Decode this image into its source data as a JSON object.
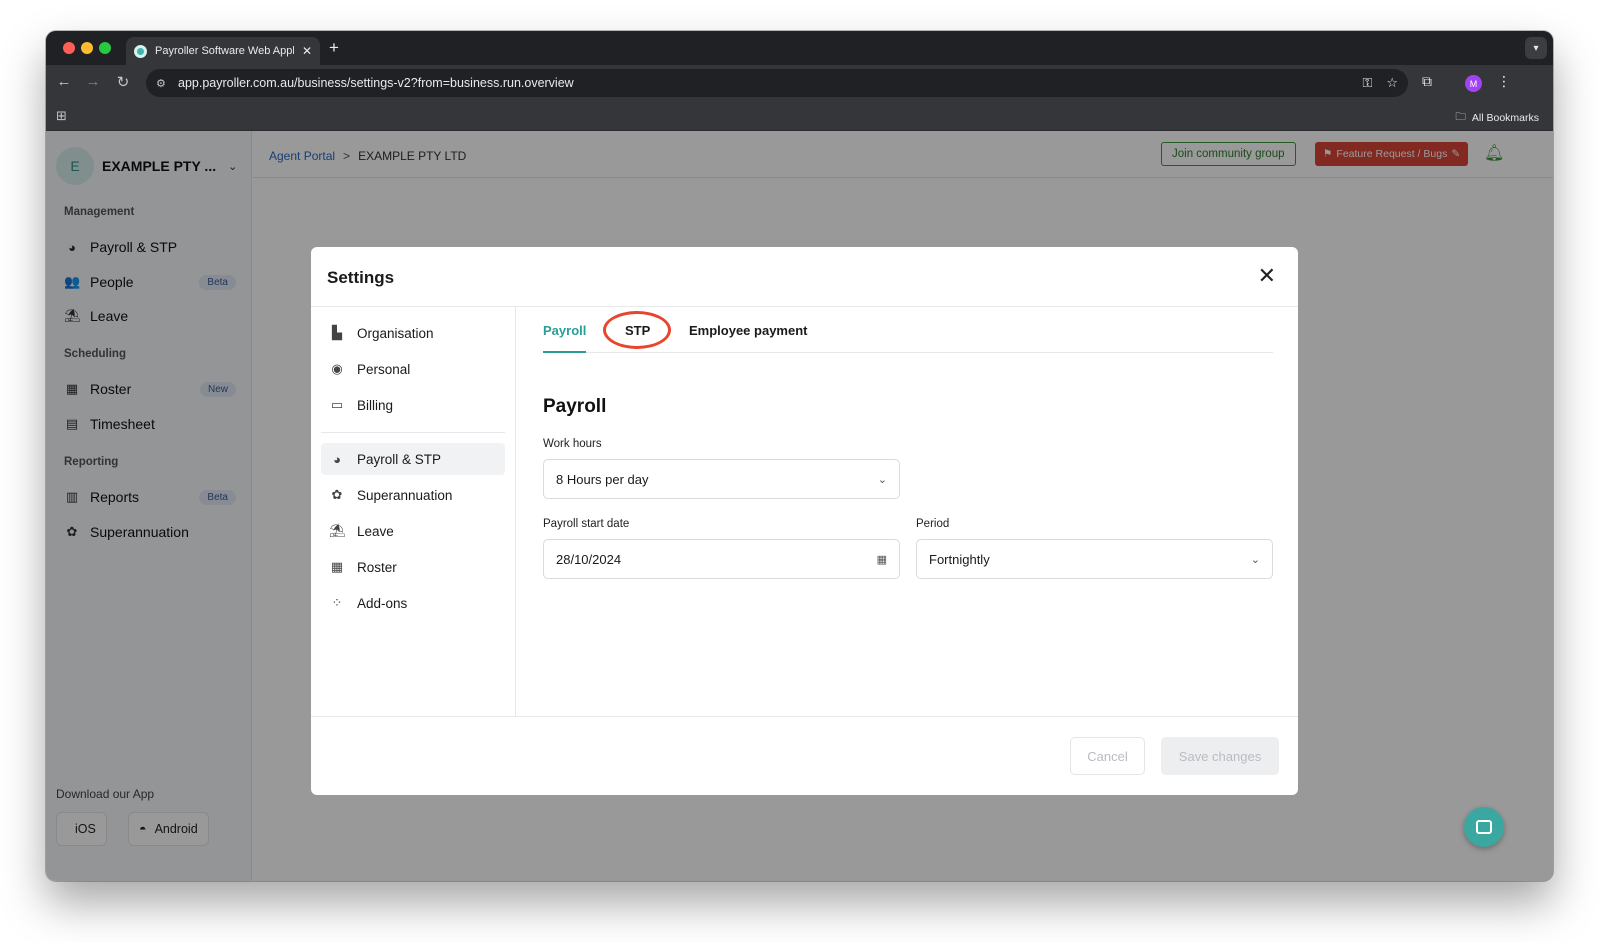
{
  "browser": {
    "tab_title": "Payroller Software Web Appli",
    "tab_close": "✕",
    "new_tab": "+",
    "url": "app.payroller.com.au/business/settings-v2?from=business.run.overview",
    "profile_initial": "M",
    "all_bookmarks": "All Bookmarks"
  },
  "sidebar": {
    "org_initial": "E",
    "org_name": "EXAMPLE PTY ...",
    "sections": {
      "management": "Management",
      "scheduling": "Scheduling",
      "reporting": "Reporting"
    },
    "items": [
      {
        "label": "Payroll & STP",
        "icon": "payroll-icon",
        "badge": ""
      },
      {
        "label": "People",
        "icon": "people-icon",
        "badge": "Beta"
      },
      {
        "label": "Leave",
        "icon": "leave-icon",
        "badge": ""
      },
      {
        "label": "Roster",
        "icon": "roster-icon",
        "badge": "New"
      },
      {
        "label": "Timesheet",
        "icon": "timesheet-icon",
        "badge": ""
      },
      {
        "label": "Reports",
        "icon": "reports-icon",
        "badge": "Beta"
      },
      {
        "label": "Superannuation",
        "icon": "superannuation-icon",
        "badge": ""
      }
    ],
    "download_title": "Download our App",
    "ios_label": "iOS",
    "android_label": "Android"
  },
  "topbar": {
    "breadcrumb_link": "Agent Portal",
    "breadcrumb_sep": ">",
    "breadcrumb_current": "EXAMPLE PTY LTD",
    "join_label": "Join community group",
    "feature_label": "Feature Request / Bugs"
  },
  "modal": {
    "title": "Settings",
    "close": "✕",
    "nav": [
      {
        "label": "Organisation",
        "icon": "organisation-icon"
      },
      {
        "label": "Personal",
        "icon": "personal-icon"
      },
      {
        "label": "Billing",
        "icon": "billing-icon"
      },
      {
        "label": "Payroll & STP",
        "icon": "payroll-icon"
      },
      {
        "label": "Superannuation",
        "icon": "superannuation-icon"
      },
      {
        "label": "Leave",
        "icon": "leave-icon"
      },
      {
        "label": "Roster",
        "icon": "roster-icon"
      },
      {
        "label": "Add-ons",
        "icon": "addons-icon"
      }
    ],
    "active_nav": "Payroll & STP",
    "tabs": {
      "payroll": "Payroll",
      "stp": "STP",
      "employee_payment": "Employee payment"
    },
    "active_tab": "Payroll",
    "highlight_color": "#e8452c",
    "section_heading": "Payroll",
    "work_hours_label": "Work hours",
    "work_hours_value": "8 Hours per day",
    "start_date_label": "Payroll start date",
    "start_date_value": "28/10/2024",
    "period_label": "Period",
    "period_value": "Fortnightly",
    "cancel_label": "Cancel",
    "save_label": "Save changes"
  },
  "colors": {
    "accent": "#2a9d97",
    "feature_red": "#d9453a",
    "join_green": "#2e7d2e"
  }
}
